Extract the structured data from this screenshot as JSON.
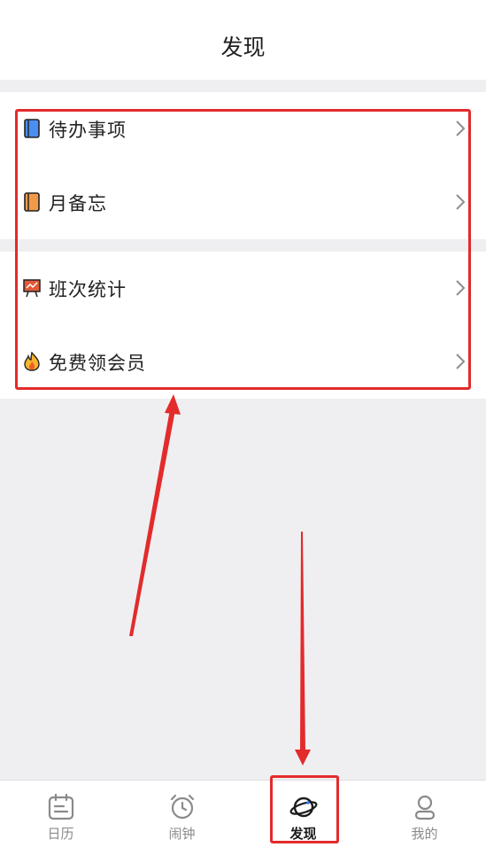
{
  "header": {
    "title": "发现"
  },
  "groups": [
    {
      "items": [
        {
          "label": "待办事项",
          "icon": "blue-book-icon"
        },
        {
          "label": "月备忘",
          "icon": "orange-book-icon"
        }
      ]
    },
    {
      "items": [
        {
          "label": "班次统计",
          "icon": "chart-board-icon"
        },
        {
          "label": "免费领会员",
          "icon": "flame-icon"
        }
      ]
    }
  ],
  "tabbar": {
    "tabs": [
      {
        "label": "日历",
        "icon": "calendar-icon"
      },
      {
        "label": "闹钟",
        "icon": "alarm-clock-icon"
      },
      {
        "label": "发现",
        "icon": "planet-icon",
        "active": true
      },
      {
        "label": "我的",
        "icon": "person-icon"
      }
    ]
  },
  "colors": {
    "annotation": "#e32b2b",
    "background": "#efeff2",
    "inactive_tab": "#8a8a8a"
  }
}
